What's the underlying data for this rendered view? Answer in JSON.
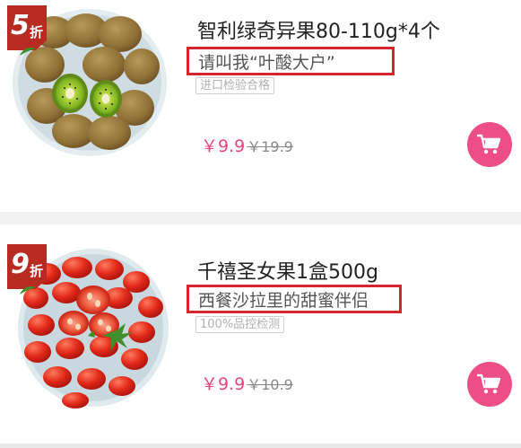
{
  "products": [
    {
      "title": "智利绿奇异果80-110g*4个",
      "subtitle": "请叫我“叶酸大户”",
      "tag": "进口检验合格",
      "price": "￥9.9",
      "original_price": "￥19.9",
      "discount_num": "5",
      "discount_unit": "折",
      "image": "kiwi-fruit-plate",
      "cart_icon": "shopping-cart-icon"
    },
    {
      "title": "千禧圣女果1盒500g",
      "subtitle": "西餐沙拉里的甜蜜伴侣",
      "tag": "100%品控检测",
      "price": "￥9.9",
      "original_price": "￥10.9",
      "discount_num": "9",
      "discount_unit": "折",
      "image": "cherry-tomato-plate",
      "cart_icon": "shopping-cart-icon"
    }
  ],
  "colors": {
    "price": "#e8457a",
    "cart_button": "#ee4e86",
    "highlight_box": "#d7262b",
    "badge": "#b72b22"
  }
}
